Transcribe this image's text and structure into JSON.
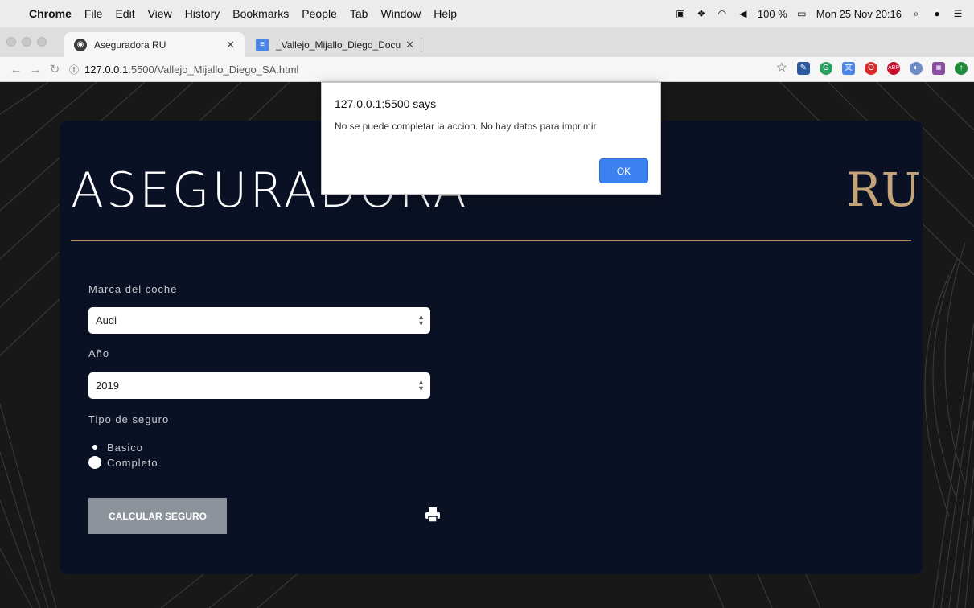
{
  "menubar": {
    "apple_icon": "apple-icon",
    "app_name": "Chrome",
    "items": [
      "File",
      "Edit",
      "View",
      "History",
      "Bookmarks",
      "People",
      "Tab",
      "Window",
      "Help"
    ],
    "battery": "100 %",
    "clock": "Mon 25 Nov 20:16"
  },
  "tabs": [
    {
      "label": "Aseguradora RU",
      "icon": "globe-icon",
      "active": true
    },
    {
      "label": "_Vallejo_Mijallo_Diego_Docume",
      "icon": "docs-icon",
      "active": false
    }
  ],
  "address": {
    "host": "127.0.0.1",
    "path": ":5500/Vallejo_Mijallo_Diego_SA.html"
  },
  "page": {
    "title": "ASEGURADORA",
    "logo_text": "RU",
    "brand_label": "Marca del coche",
    "brand_value": "Audi",
    "year_label": "Año",
    "year_value": "2019",
    "insurance_label": "Tipo de seguro",
    "option_basic": "Basico",
    "option_full": "Completo",
    "selected_option": "Basico",
    "calc_button": "CALCULAR SEGURO"
  },
  "dialog": {
    "title": "127.0.0.1:5500 says",
    "message": "No se puede completar la accion. No hay datos para imprimir",
    "ok": "OK"
  },
  "colors": {
    "card_bg": "#0b1124",
    "accent_gold": "#c5a378",
    "ok_button": "#3b82f0",
    "calc_button": "#8d939a"
  }
}
